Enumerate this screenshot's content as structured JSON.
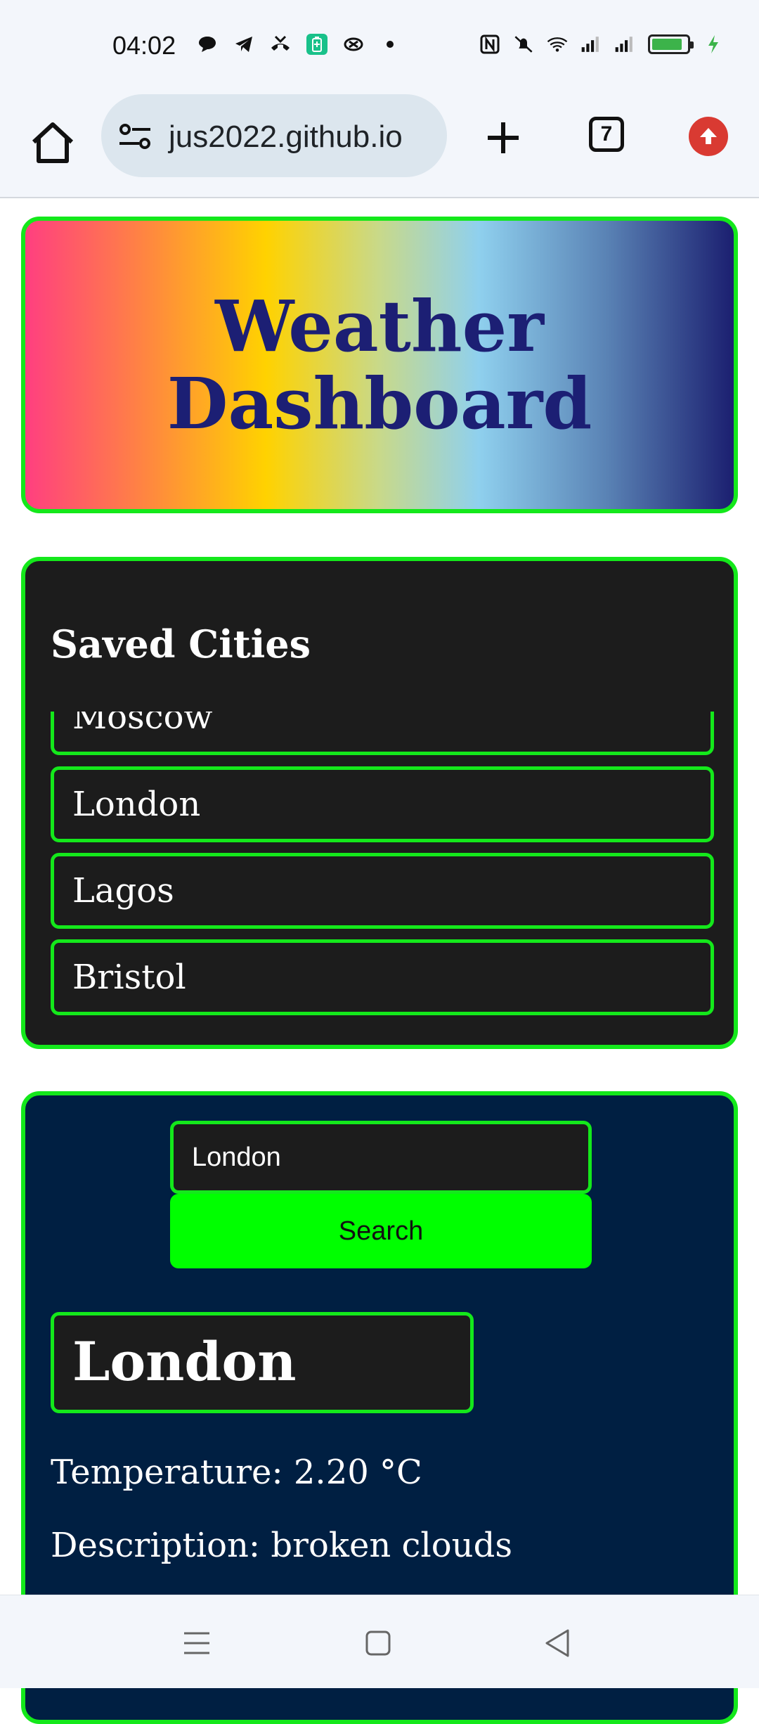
{
  "status_bar": {
    "time": "04:02",
    "left_icons": [
      "chat-bubble-icon",
      "telegram-icon",
      "missed-call-icon",
      "battery-saver-icon",
      "link-icon",
      "dot-icon"
    ],
    "right_icons": [
      "nfc-icon",
      "mute-icon",
      "wifi-icon",
      "signal-icon",
      "signal-icon",
      "battery-icon",
      "charging-icon"
    ],
    "battery_level": 0.75
  },
  "browser": {
    "url": "jus2022.github.io",
    "tab_count": "7"
  },
  "header": {
    "title": "Weather Dashboard"
  },
  "saved_cities": {
    "title": "Saved Cities",
    "cities": [
      "Moscow",
      "London",
      "Lagos",
      "Bristol"
    ]
  },
  "search": {
    "input_value": "London",
    "button_label": "Search"
  },
  "weather": {
    "city": "London",
    "temperature": "Temperature: 2.20 °C",
    "description": "Description: broken clouds"
  },
  "colors": {
    "accent_green": "#14e81b",
    "button_green": "#00ff00",
    "card_dark": "#1c1c1c",
    "search_bg": "#001f42",
    "title_navy": "#1c1f74"
  }
}
